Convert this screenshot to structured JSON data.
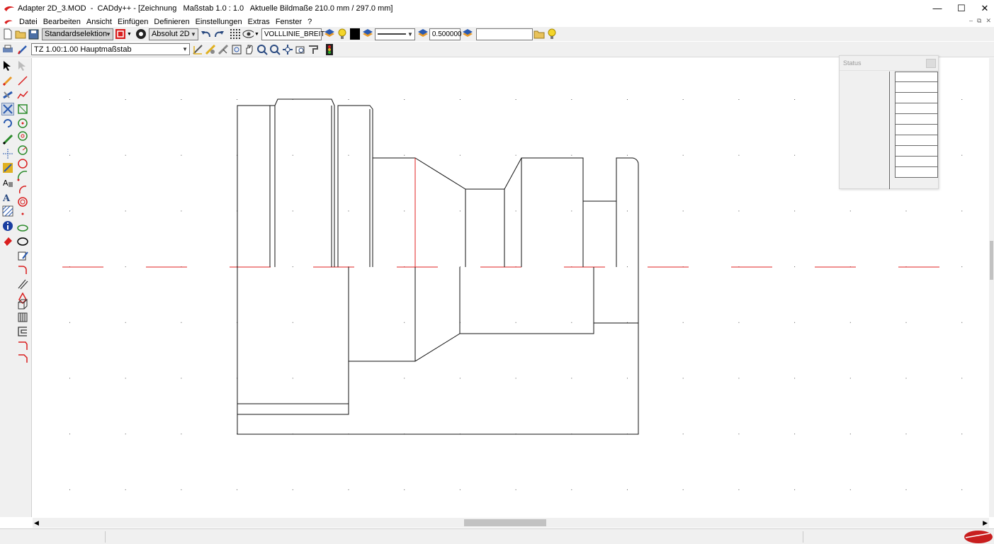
{
  "window": {
    "title": "Adapter 2D_3.MOD  -  CADdy++ - [Zeichnung   Maßstab 1.0 : 1.0   Aktuelle Bildmaße 210.0 mm / 297.0 mm]",
    "minimize": "—",
    "maximize": "☐",
    "close": "✕"
  },
  "menu": [
    "Datei",
    "Bearbeiten",
    "Ansicht",
    "Einfügen",
    "Definieren",
    "Einstellungen",
    "Extras",
    "Fenster",
    "?"
  ],
  "mdi": {
    "minimize": "–",
    "restore": "⧉",
    "close": "✕"
  },
  "toolbar1": {
    "selection_mode": "Standardselektion",
    "coord_mode": "Absolut 2D",
    "line_type": "VOLLLINIE_BREIT",
    "line_width": "0.500000",
    "extra_field": ""
  },
  "toolbar2": {
    "scale": "TZ 1.00:1.00 Hauptmaßstab"
  },
  "status_panel": {
    "title": "Status",
    "rows": 10
  },
  "colors": {
    "accent_red": "#d91e1e",
    "line_black": "#111111",
    "center_red": "#e02020"
  }
}
